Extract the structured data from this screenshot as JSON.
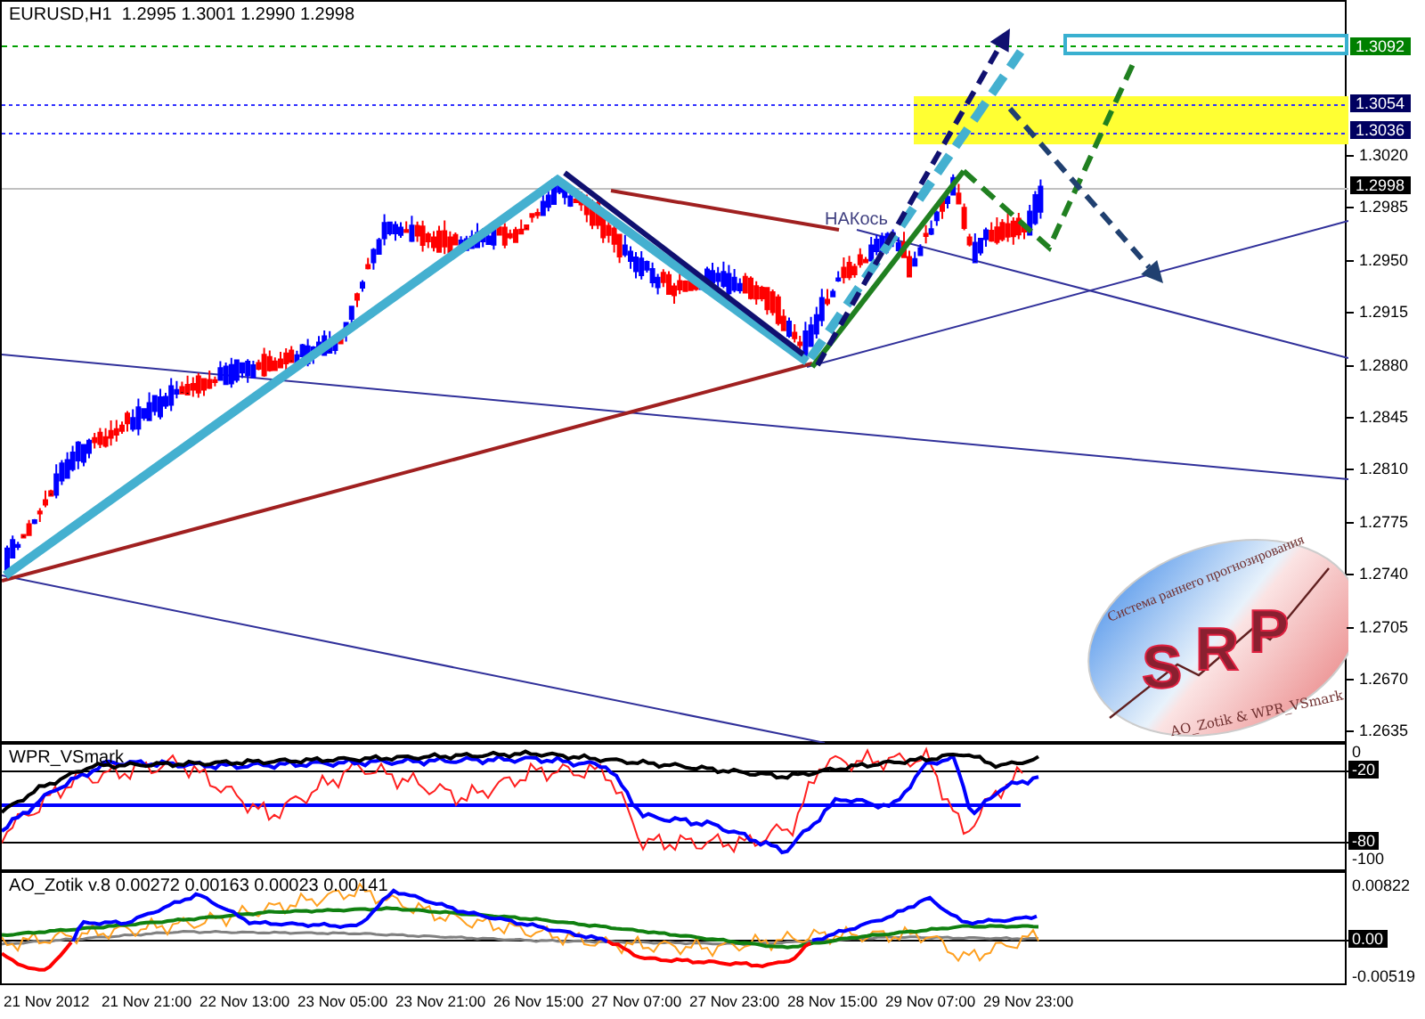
{
  "main_chart": {
    "title": "EURUSD,H1",
    "quote": "1.2995 1.3001 1.2990 1.2998",
    "annotation": "НАКось",
    "logo": {
      "arc_text": "Система раннего прогнозирования",
      "letters": [
        "S",
        "R",
        "P"
      ],
      "credit": "AO_Zotik & WPR_VSmark"
    }
  },
  "price_axis": {
    "markers": [
      {
        "text": "1.3092",
        "color": "#008000"
      },
      {
        "text": "1.3054",
        "color": "#000060"
      },
      {
        "text": "1.3036",
        "color": "#000060"
      },
      {
        "text": "1.2998",
        "color": "#000000"
      }
    ],
    "ticks": [
      "1.3020",
      "1.2985",
      "1.2950",
      "1.2915",
      "1.2880",
      "1.2845",
      "1.2810",
      "1.2775",
      "1.2740",
      "1.2705",
      "1.2670",
      "1.2635"
    ]
  },
  "wpr_panel": {
    "title": "WPR_VSmark",
    "axis": [
      {
        "text": "0",
        "highlighted": false
      },
      {
        "text": "-20",
        "highlighted": true
      },
      {
        "text": "-80",
        "highlighted": true
      },
      {
        "text": "-100",
        "highlighted": false
      }
    ]
  },
  "ao_panel": {
    "title": "AO_Zotik v.8 0.00272 0.00163 0.00023 0.00141",
    "axis": [
      {
        "text": "0.00822",
        "highlighted": false
      },
      {
        "text": "0.00",
        "highlighted": true
      },
      {
        "text": "-0.00519",
        "highlighted": false
      }
    ]
  },
  "time_axis": [
    "21 Nov 2012",
    "21 Nov 21:00",
    "22 Nov 13:00",
    "23 Nov 05:00",
    "23 Nov 21:00",
    "26 Nov 15:00",
    "27 Nov 07:00",
    "27 Nov 23:00",
    "28 Nov 15:00",
    "29 Nov 07:00",
    "29 Nov 23:00"
  ]
}
